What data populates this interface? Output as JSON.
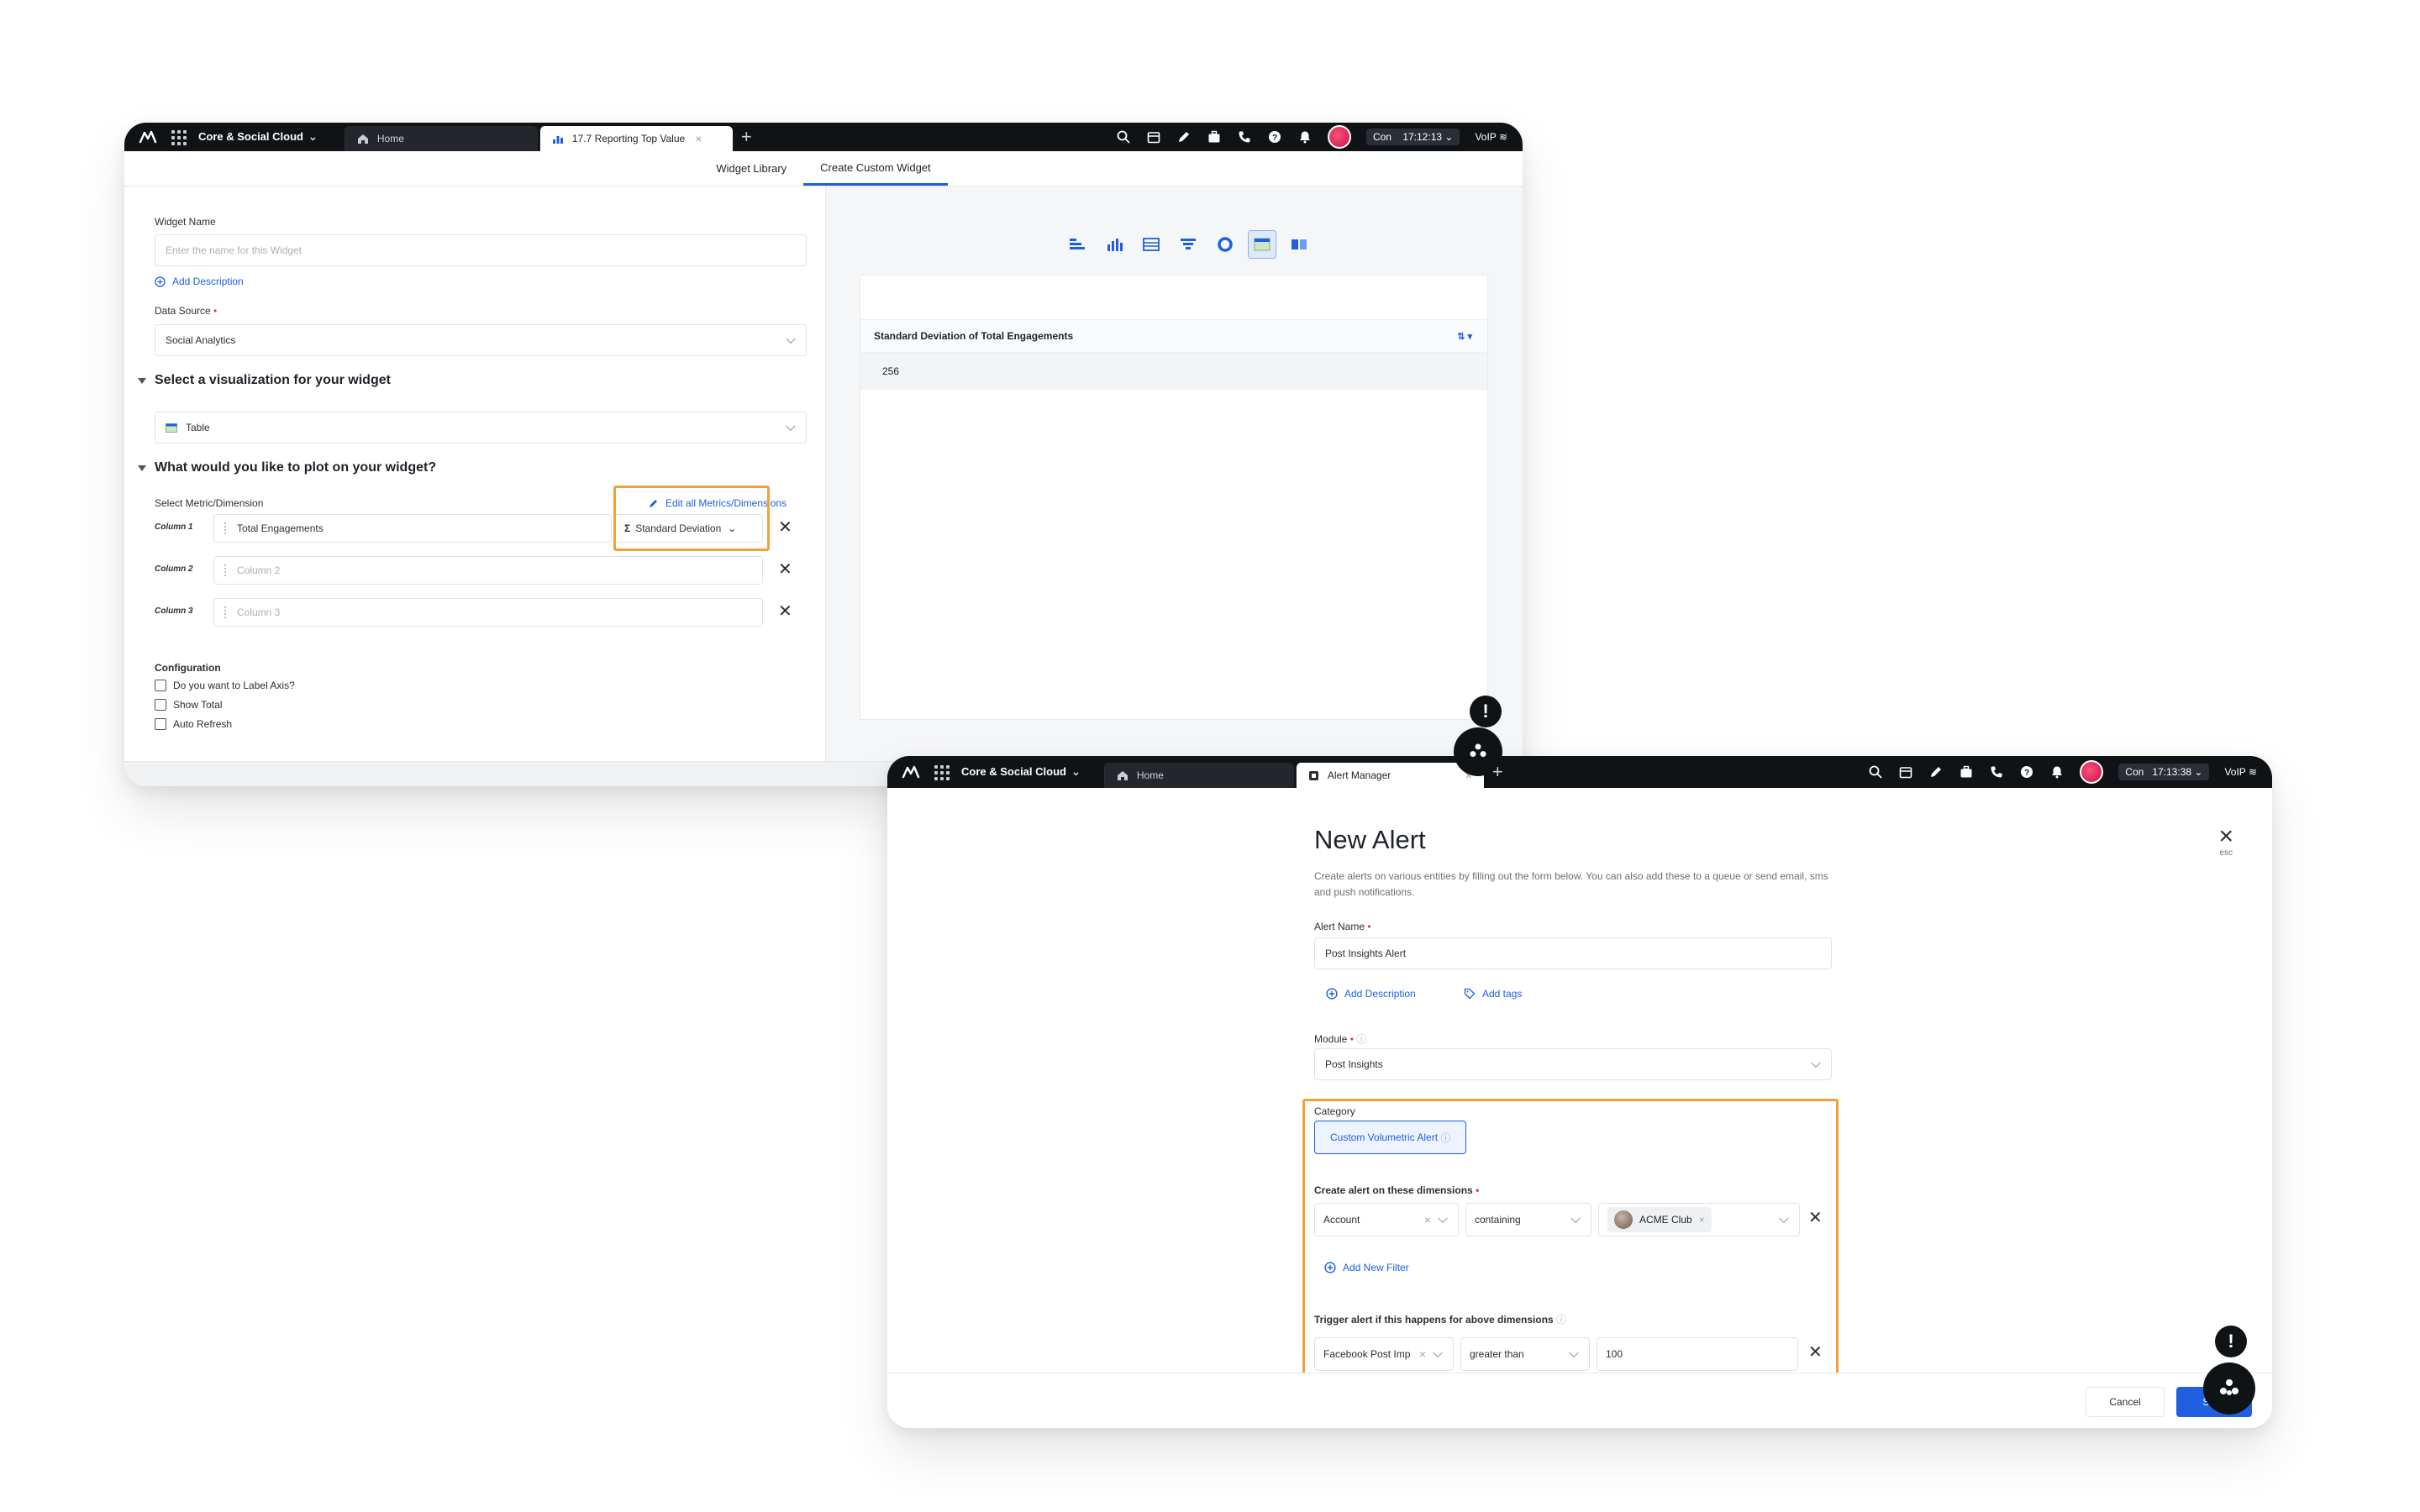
{
  "win1": {
    "topbar": {
      "brand": "Core & Social Cloud",
      "home_tab": "Home",
      "active_tab": "17.7 Reporting Top Value",
      "status_pill": "Con",
      "time": "17:12:13",
      "voip": "VoIP"
    },
    "subtabs": [
      "Widget Library",
      "Create Custom Widget"
    ],
    "form": {
      "widget_name_label": "Widget Name",
      "widget_name_placeholder": "Enter the name for this Widget",
      "add_description": "Add Description",
      "data_source_label": "Data Source",
      "data_source_value": "Social Analytics",
      "viz_section": "Select a visualization for your widget",
      "viz_value": "Table",
      "plot_section": "What would you like to plot on your widget?",
      "metric_label": "Select Metric/Dimension",
      "edit_all": "Edit all Metrics/Dimensions",
      "columns": [
        {
          "label": "Column 1",
          "value": "Total Engagements",
          "agg": "Standard Deviation"
        },
        {
          "label": "Column 2",
          "placeholder": "Column 2"
        },
        {
          "label": "Column 3",
          "placeholder": "Column 3"
        }
      ],
      "configuration_label": "Configuration",
      "checkboxes": [
        "Do you want to Label Axis?",
        "Show Total",
        "Auto Refresh"
      ]
    },
    "preview": {
      "header": "Standard Deviation of Total Engagements",
      "value": "256"
    }
  },
  "win2": {
    "topbar": {
      "brand": "Core & Social Cloud",
      "home_tab": "Home",
      "active_tab": "Alert Manager",
      "status_pill": "Con",
      "time": "17:13:38",
      "voip": "VoIP"
    },
    "title": "New Alert",
    "description": "Create alerts on various entities by filling out the form below. You can also add these to a queue or send email, sms and push notifications.",
    "esc": "esc",
    "alert_name_label": "Alert Name",
    "alert_name_value": "Post Insights Alert",
    "add_description": "Add Description",
    "add_tags": "Add tags",
    "module_label": "Module",
    "module_value": "Post Insights",
    "category_label": "Category",
    "category_value": "Custom Volumetric Alert",
    "dimensions_label": "Create alert on these dimensions",
    "dimension_row": {
      "field": "Account",
      "operator": "containing",
      "value": "ACME Club"
    },
    "add_filter": "Add New Filter",
    "trigger_label": "Trigger alert if this happens for above dimensions",
    "trigger_row": {
      "field": "Facebook Post Imp",
      "operator": "greater than",
      "value": "100"
    },
    "cancel": "Cancel",
    "save": "Save"
  },
  "colors": {
    "accent": "#1f5fe0",
    "highlight": "#f2a13a",
    "topbar": "#101316"
  }
}
